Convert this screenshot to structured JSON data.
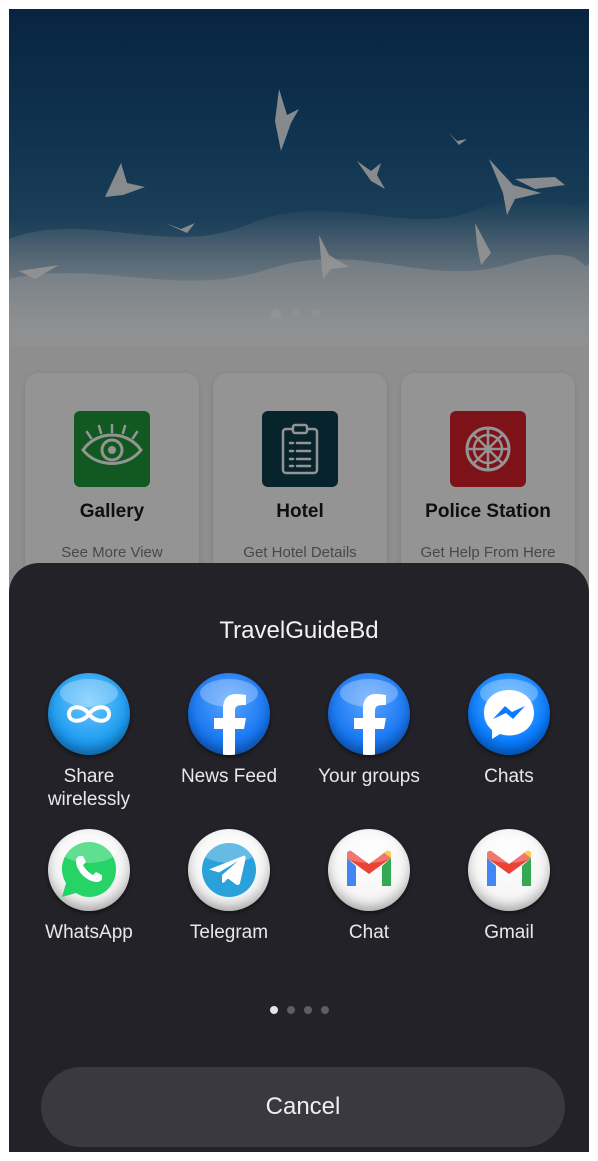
{
  "background_app": {
    "cards": [
      {
        "icon": "eye-icon",
        "title": "Gallery",
        "subtitle": "See More View",
        "color": "#1f9a3a"
      },
      {
        "icon": "clipboard-icon",
        "title": "Hotel",
        "subtitle": "Get Hotel Details From Here",
        "color": "#0d3e4d"
      },
      {
        "icon": "ship-wheel-icon",
        "title": "Police Station",
        "subtitle": "Get Help From Here",
        "color": "#d71f2a"
      }
    ]
  },
  "share_sheet": {
    "title": "TravelGuideBd",
    "apps": [
      {
        "label": "Share wirelessly",
        "icon": "infinity-icon",
        "color": "#1e9cf0"
      },
      {
        "label": "News Feed",
        "icon": "facebook-icon",
        "color": "#1877f2"
      },
      {
        "label": "Your groups",
        "icon": "facebook-icon",
        "color": "#1877f2"
      },
      {
        "label": "Chats",
        "icon": "messenger-icon",
        "color": "#0a7cff"
      },
      {
        "label": "WhatsApp",
        "icon": "whatsapp-icon",
        "color": "#25d366"
      },
      {
        "label": "Telegram",
        "icon": "telegram-icon",
        "color": "#2aa1da"
      },
      {
        "label": "Chat",
        "icon": "gmail-icon",
        "color": "#ffffff"
      },
      {
        "label": "Gmail",
        "icon": "gmail-icon",
        "color": "#ffffff"
      }
    ],
    "page_indicator": {
      "pages": 4,
      "current": 1
    },
    "cancel_label": "Cancel"
  },
  "colors": {
    "sheet_background": "#232228",
    "cancel_background": "#3a393f"
  }
}
